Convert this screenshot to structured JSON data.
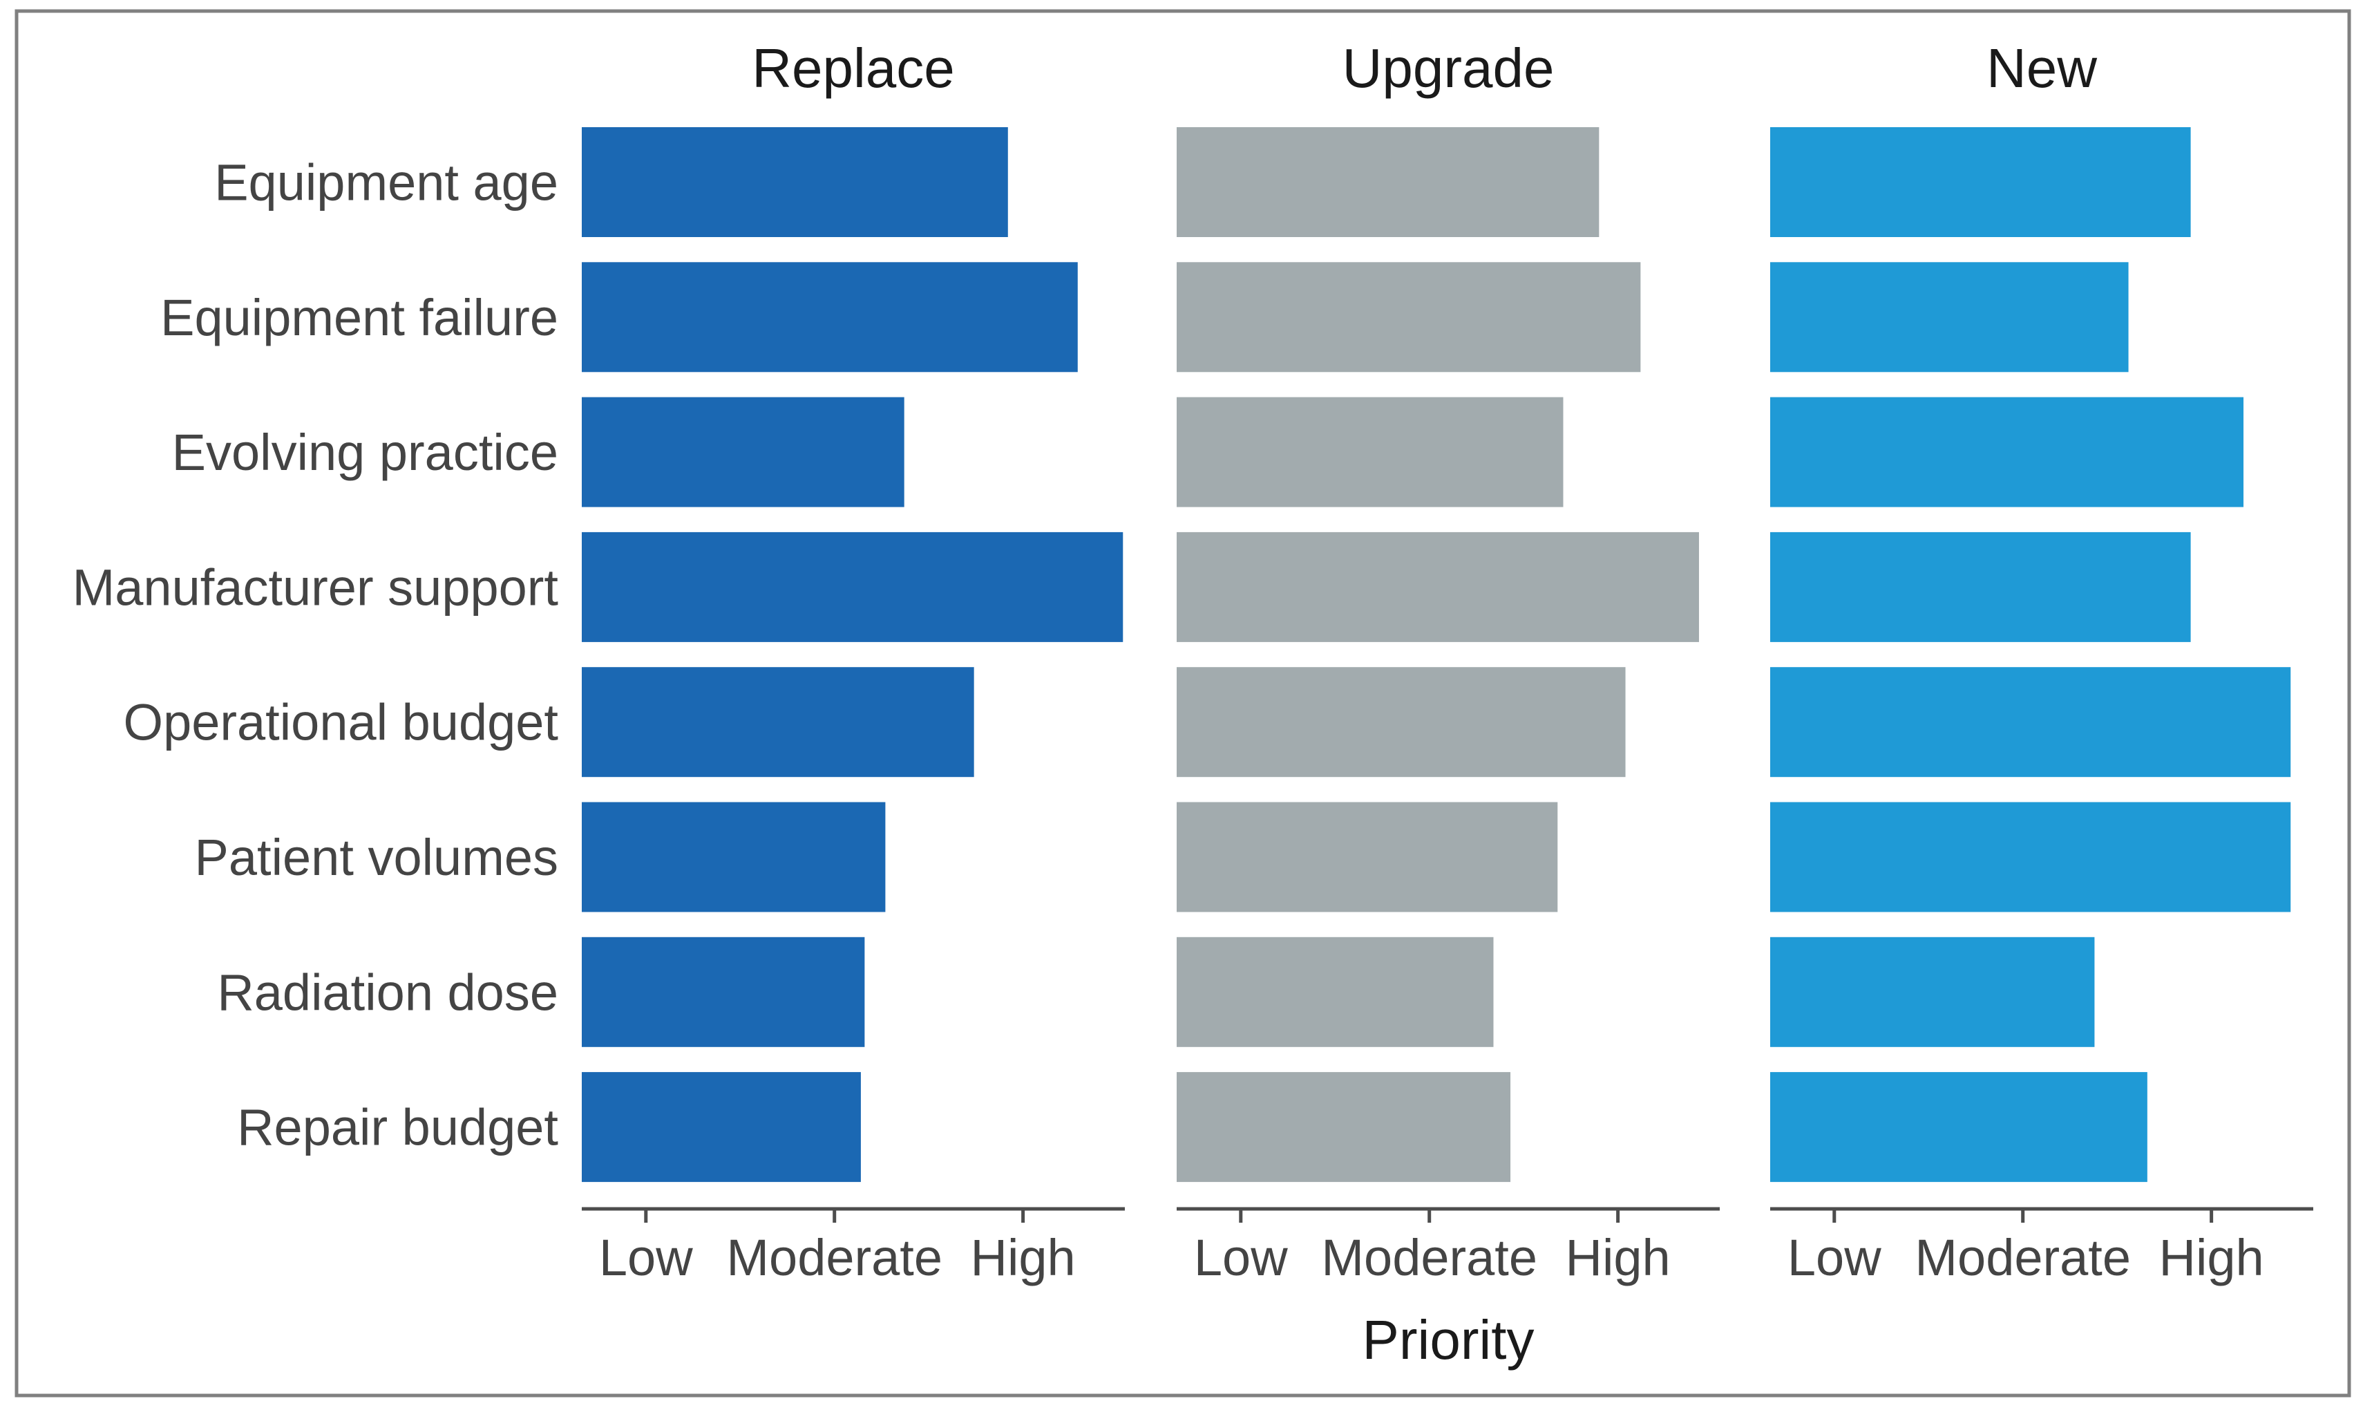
{
  "chart_data": {
    "type": "bar",
    "orientation": "horizontal",
    "layout": "small-multiples",
    "title": "",
    "xlabel": "Priority",
    "ylabel": "",
    "x_ticks": [
      {
        "label": "Low",
        "value": 1
      },
      {
        "label": "Moderate",
        "value": 2
      },
      {
        "label": "High",
        "value": 3
      }
    ],
    "xlim": [
      0.66,
      3.54
    ],
    "grid": false,
    "legend": "none",
    "categories": [
      "Equipment age",
      "Equipment failure",
      "Evolving practice",
      "Manufacturer support",
      "Operational budget",
      "Patient volumes",
      "Radiation dose",
      "Repair budget"
    ],
    "series": [
      {
        "name": "Replace",
        "color": "#1B68B3",
        "values": [
          2.92,
          3.29,
          2.37,
          3.53,
          2.74,
          2.27,
          2.16,
          2.14
        ]
      },
      {
        "name": "Upgrade",
        "color": "#A2ABAE",
        "values": [
          2.9,
          3.12,
          2.71,
          3.43,
          3.04,
          2.68,
          2.34,
          2.43
        ]
      },
      {
        "name": "New",
        "color": "#1F9AD6",
        "values": [
          2.89,
          2.56,
          3.17,
          2.89,
          3.42,
          3.42,
          2.38,
          2.66
        ]
      }
    ]
  }
}
